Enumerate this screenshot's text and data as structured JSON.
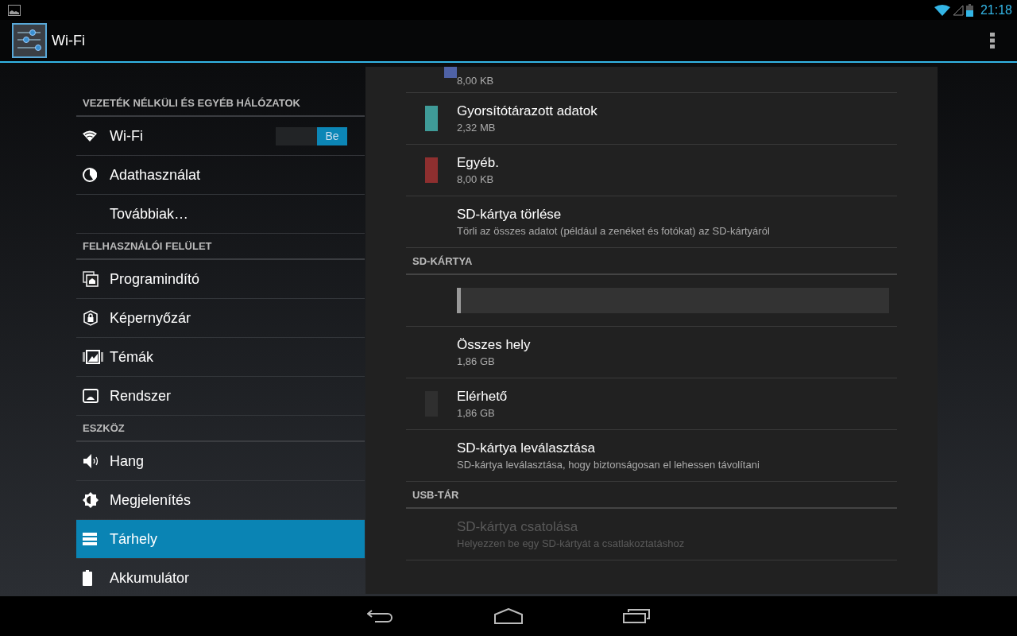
{
  "status_bar": {
    "time": "21:18"
  },
  "action_bar": {
    "title": "Wi-Fi"
  },
  "sidebar": {
    "sections": [
      {
        "header": "VEZETÉK NÉLKÜLI ÉS EGYÉB HÁLÓZATOK",
        "items": [
          {
            "label": "Wi-Fi",
            "selected": false,
            "toggle": {
              "label": "Be",
              "on": true
            }
          },
          {
            "label": "Adathasználat",
            "selected": false
          },
          {
            "label": "Továbbiak…",
            "selected": false
          }
        ]
      },
      {
        "header": "FELHASZNÁLÓI FELÜLET",
        "items": [
          {
            "label": "Programindító",
            "selected": false
          },
          {
            "label": "Képernyőzár",
            "selected": false
          },
          {
            "label": "Témák",
            "selected": false
          },
          {
            "label": "Rendszer",
            "selected": false
          }
        ]
      },
      {
        "header": "ESZKÖZ",
        "items": [
          {
            "label": "Hang",
            "selected": false
          },
          {
            "label": "Megjelenítés",
            "selected": false
          },
          {
            "label": "Tárhely",
            "selected": true
          },
          {
            "label": "Akkumulátor",
            "selected": false
          }
        ]
      }
    ]
  },
  "storage": {
    "rows": [
      {
        "kind": "clipped",
        "color": "#4f62a6",
        "subtitle": "8,00 KB"
      },
      {
        "kind": "legend",
        "color": "#3f9b98",
        "title": "Gyorsítótárazott adatok",
        "subtitle": "2,32 MB"
      },
      {
        "kind": "legend",
        "color": "#8e2f2f",
        "title": "Egyéb.",
        "subtitle": "8,00 KB"
      },
      {
        "kind": "action",
        "title": "SD-kártya törlése",
        "subtitle": "Törli az összes adatot (például a zenéket és fotókat) az SD-kártyáról",
        "disabled": false
      },
      {
        "kind": "header",
        "title": "SD-KÁRTYA"
      },
      {
        "kind": "bar",
        "level": 0.01
      },
      {
        "kind": "action",
        "title": "Összes hely",
        "subtitle": "1,86 GB",
        "disabled": false
      },
      {
        "kind": "legend",
        "color": "#2f2f2f",
        "title": "Elérhető",
        "subtitle": "1,86 GB"
      },
      {
        "kind": "action",
        "title": "SD-kártya leválasztása",
        "subtitle": "SD-kártya leválasztása, hogy biztonságosan el lehessen távolítani",
        "disabled": false
      },
      {
        "kind": "header",
        "title": "USB-TÁR"
      },
      {
        "kind": "action",
        "title": "SD-kártya csatolása",
        "subtitle": "Helyezzen be egy SD-kártyát a csatlakoztatáshoz",
        "disabled": true
      }
    ]
  }
}
